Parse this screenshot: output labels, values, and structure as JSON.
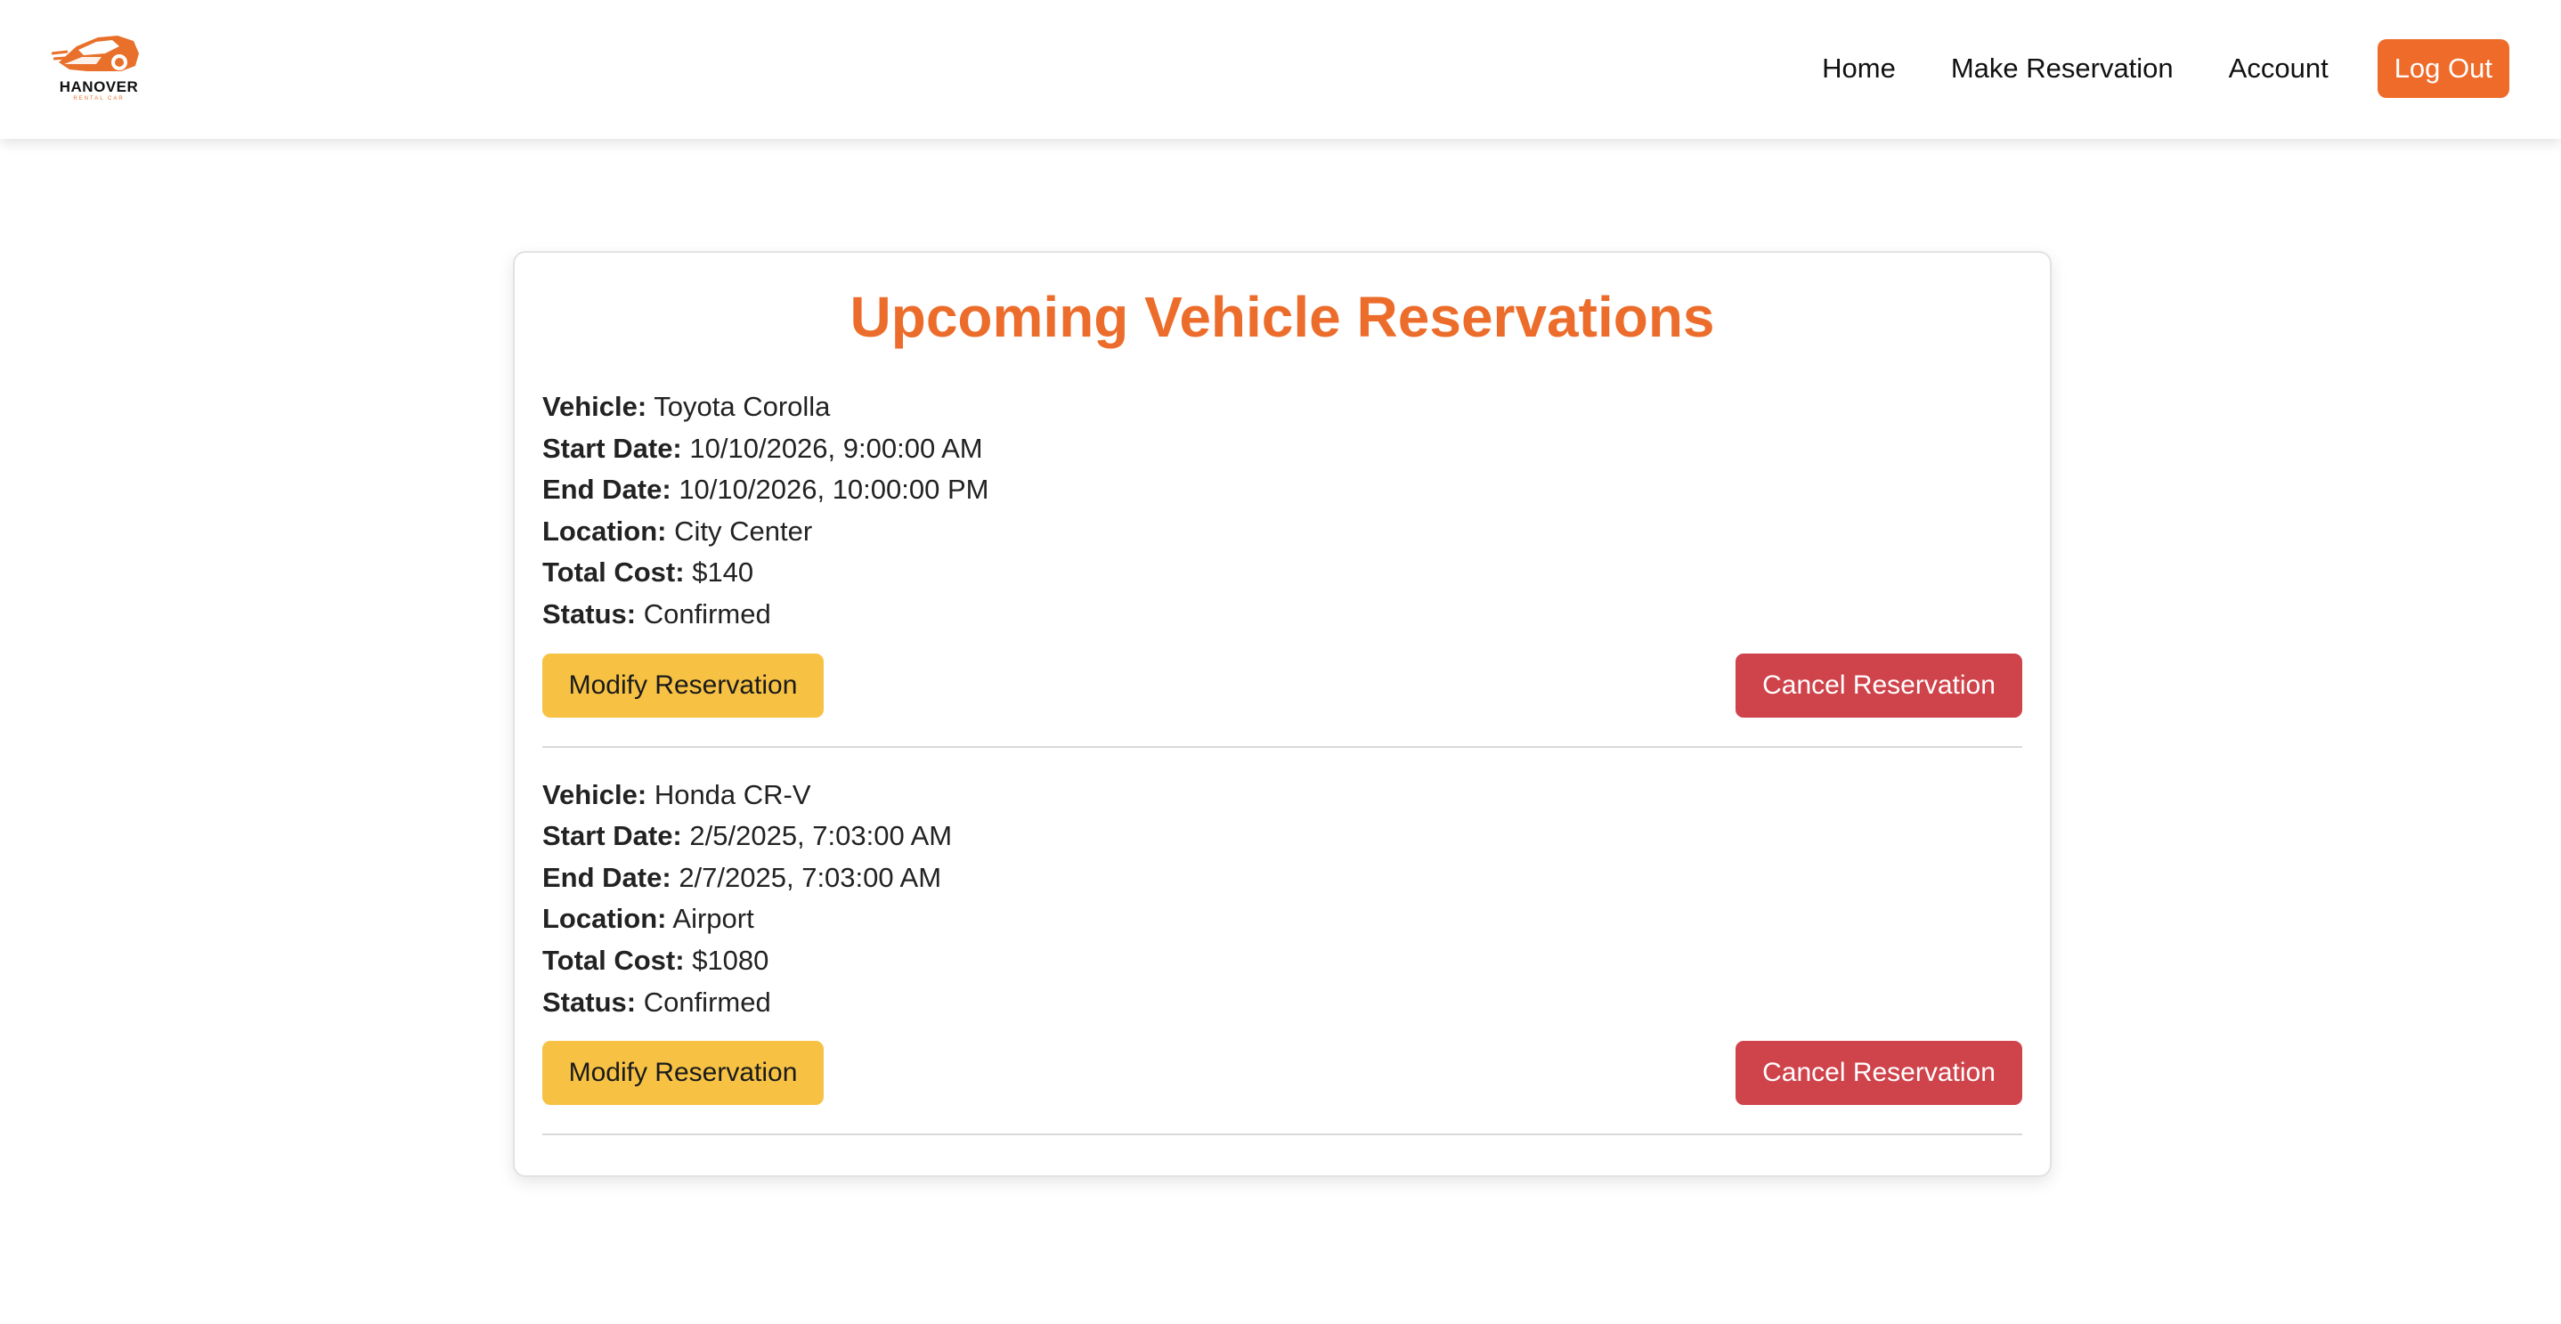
{
  "header": {
    "logo_text": "HANOVER",
    "logo_subtext": "RENTAL CAR",
    "nav": [
      "Home",
      "Make Reservation",
      "Account"
    ],
    "logout_label": "Log Out"
  },
  "main": {
    "title": "Upcoming Vehicle Reservations",
    "labels": {
      "vehicle": "Vehicle:",
      "start": "Start Date:",
      "end": "End Date:",
      "location": "Location:",
      "cost": "Total Cost:",
      "status": "Status:"
    },
    "reservations": [
      {
        "vehicle": "Toyota Corolla",
        "start": "10/10/2026, 9:00:00 AM",
        "end": "10/10/2026, 10:00:00 PM",
        "location": "City Center",
        "cost": "$140",
        "status": "Confirmed"
      },
      {
        "vehicle": "Honda CR-V",
        "start": "2/5/2025, 7:03:00 AM",
        "end": "2/7/2025, 7:03:00 AM",
        "location": "Airport",
        "cost": "$1080",
        "status": "Confirmed"
      }
    ],
    "modify_label": "Modify Reservation",
    "cancel_label": "Cancel Reservation"
  },
  "colors": {
    "accent": "#ec6d2b",
    "modify": "#f7c244",
    "cancel": "#cf434b"
  }
}
